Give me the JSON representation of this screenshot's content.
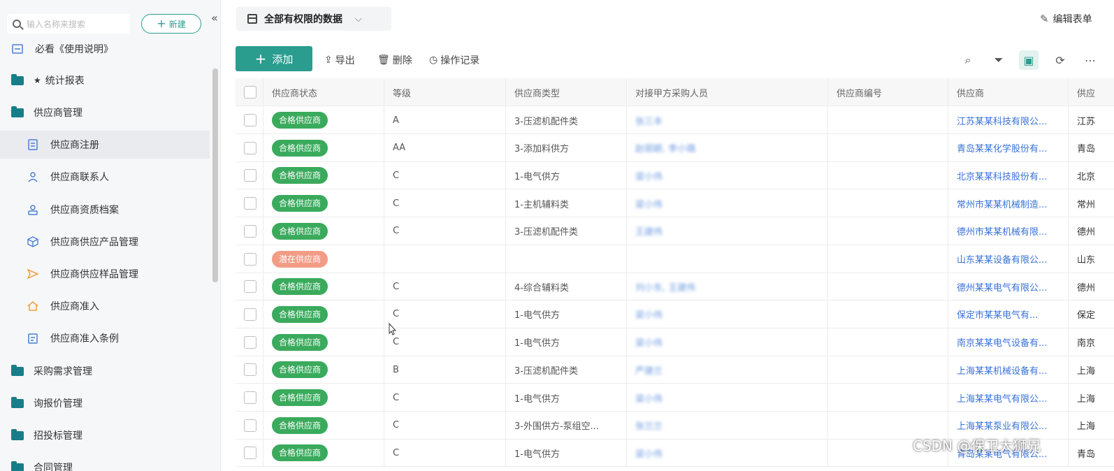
{
  "sidebar": {
    "search_placeholder": "输入名称来搜索",
    "new_label": "新建",
    "collapse_glyph": "«",
    "items": [
      {
        "label": "必看《使用说明》",
        "level": "top",
        "icon": "document-icon"
      },
      {
        "label": "统计报表",
        "level": "top",
        "icon": "folder-icon",
        "star": "★"
      },
      {
        "label": "供应商管理",
        "level": "top",
        "icon": "folder-icon"
      },
      {
        "label": "供应商注册",
        "level": "sub",
        "icon": "form-icon",
        "selected": true
      },
      {
        "label": "供应商联系人",
        "level": "sub",
        "icon": "person-icon"
      },
      {
        "label": "供应商资质档案",
        "level": "sub",
        "icon": "person-badge-icon"
      },
      {
        "label": "供应商供应产品管理",
        "level": "sub",
        "icon": "cube-icon"
      },
      {
        "label": "供应商供应样品管理",
        "level": "sub",
        "icon": "send-icon"
      },
      {
        "label": "供应商准入",
        "level": "sub",
        "icon": "home-icon"
      },
      {
        "label": "供应商准入条例",
        "level": "sub",
        "icon": "clipboard-icon"
      },
      {
        "label": "采购需求管理",
        "level": "top",
        "icon": "folder-icon"
      },
      {
        "label": "询报价管理",
        "level": "top",
        "icon": "folder-icon"
      },
      {
        "label": "招投标管理",
        "level": "top",
        "icon": "folder-icon"
      },
      {
        "label": "合同管理",
        "level": "top",
        "icon": "folder-icon"
      }
    ]
  },
  "header": {
    "view_name": "全部有权限的数据",
    "edit_form": "编辑表单"
  },
  "toolbar": {
    "add": "添加",
    "export": "导出",
    "delete": "删除",
    "history": "操作记录"
  },
  "table": {
    "columns": [
      "供应商状态",
      "等级",
      "供应商类型",
      "对接甲方采购人员",
      "供应商编号",
      "供应商",
      "供应"
    ],
    "rows": [
      {
        "status": "合格供应商",
        "status_type": "ok",
        "grade": "A",
        "type": "3-压滤机配件类",
        "buyer": "张三丰",
        "code": "",
        "supplier": "江苏某某科技有限公...",
        "extra": "江苏"
      },
      {
        "status": "合格供应商",
        "status_type": "ok",
        "grade": "AA",
        "type": "3-添加料供方",
        "buyer": "赵丽颖, 李小璐",
        "code": "",
        "supplier": "青岛某某化学股份有...",
        "extra": "青岛"
      },
      {
        "status": "合格供应商",
        "status_type": "ok",
        "grade": "C",
        "type": "1-电气供方",
        "buyer": "梁小伟",
        "code": "",
        "supplier": "北京某某科技股份有...",
        "extra": "北京"
      },
      {
        "status": "合格供应商",
        "status_type": "ok",
        "grade": "C",
        "type": "1-主机辅料类",
        "buyer": "梁小伟",
        "code": "",
        "supplier": "常州市某某机械制造...",
        "extra": "常州"
      },
      {
        "status": "合格供应商",
        "status_type": "ok",
        "grade": "C",
        "type": "3-压滤机配件类",
        "buyer": "王建伟",
        "code": "",
        "supplier": "德州市某某机械有限...",
        "extra": "德州"
      },
      {
        "status": "潜在供应商",
        "status_type": "pot",
        "grade": "",
        "type": "",
        "buyer": "",
        "code": "",
        "supplier": "山东某某设备有限公...",
        "extra": "山东"
      },
      {
        "status": "合格供应商",
        "status_type": "ok",
        "grade": "C",
        "type": "4-综合辅料类",
        "buyer": "刘小东, 王建伟",
        "code": "",
        "supplier": "德州某某电气有限公...",
        "extra": "德州"
      },
      {
        "status": "合格供应商",
        "status_type": "ok",
        "grade": "C",
        "type": "1-电气供方",
        "buyer": "梁小伟",
        "code": "",
        "supplier": "保定市某某电气有...",
        "extra": "保定"
      },
      {
        "status": "合格供应商",
        "status_type": "ok",
        "grade": "C",
        "type": "1-电气供方",
        "buyer": "梁小伟",
        "code": "",
        "supplier": "南京某某电气设备有...",
        "extra": "南京"
      },
      {
        "status": "合格供应商",
        "status_type": "ok",
        "grade": "B",
        "type": "3-压滤机配件类",
        "buyer": "严建兰",
        "code": "",
        "supplier": "上海某某机械设备有...",
        "extra": "上海"
      },
      {
        "status": "合格供应商",
        "status_type": "ok",
        "grade": "C",
        "type": "1-电气供方",
        "buyer": "梁小伟",
        "code": "",
        "supplier": "上海某某电气有限公...",
        "extra": "上海"
      },
      {
        "status": "合格供应商",
        "status_type": "ok",
        "grade": "C",
        "type": "3-外围供方-泵组空...",
        "buyer": "张兰兰",
        "code": "",
        "supplier": "上海某某泵业有限公...",
        "extra": "上海"
      },
      {
        "status": "合格供应商",
        "status_type": "ok",
        "grade": "C",
        "type": "1-电气供方",
        "buyer": "梁小伟",
        "code": "",
        "supplier": "青岛某某电气有限公...",
        "extra": "青岛"
      }
    ]
  },
  "watermark": "CSDN @保卫大狮兄",
  "colors": {
    "accent": "#2a9d8f",
    "ok_badge": "#3aaa5c",
    "potential_badge": "#f29c85",
    "link": "#3a72d8"
  }
}
